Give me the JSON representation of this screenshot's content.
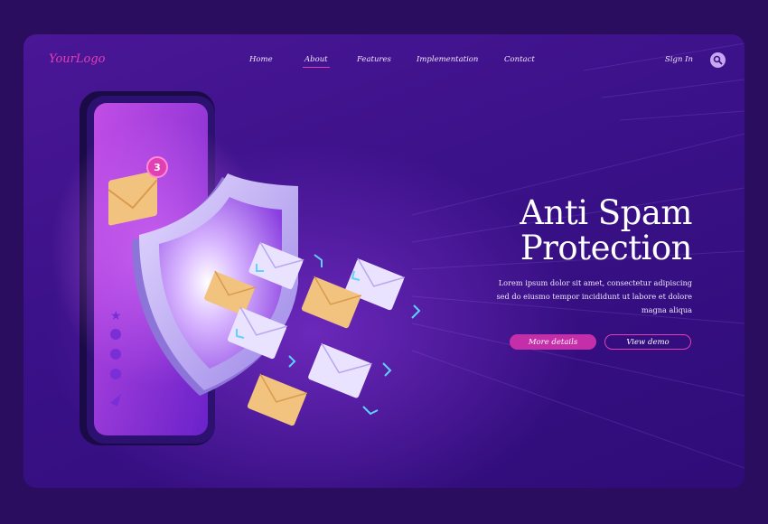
{
  "brand": {
    "logo": "YourLogo"
  },
  "nav": {
    "items": [
      {
        "label": "Home"
      },
      {
        "label": "About"
      },
      {
        "label": "Features"
      },
      {
        "label": "Implementation"
      },
      {
        "label": "Contact"
      }
    ],
    "active": "About",
    "sign_in": "Sign In"
  },
  "hero": {
    "title_line1": "Anti Spam",
    "title_line2": "Protection",
    "body_line1": "Lorem ipsum dolor sit amet, consectetur adipiscing",
    "body_line2": "sed do eiusmo tempor incididunt ut labore et dolore",
    "body_line3": "magna aliqua",
    "primary_button": "More details",
    "secondary_button": "View demo"
  },
  "illustration": {
    "notification_count": "3",
    "icons": [
      "star-icon",
      "phone-icon",
      "chat-icon",
      "mail-icon",
      "send-icon"
    ]
  },
  "colors": {
    "accent": "#e23fb4",
    "background": "#3a1188",
    "envelope_white": "#eae3ff",
    "envelope_yellow": "#f2c27f",
    "shield": "#c5b4f5"
  }
}
